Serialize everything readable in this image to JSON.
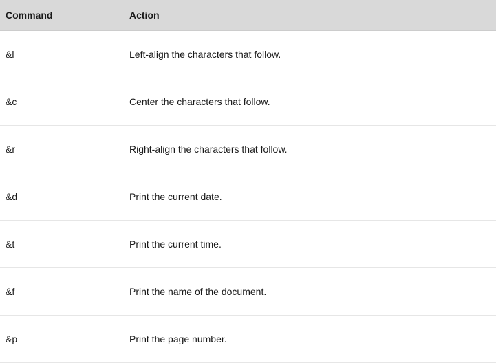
{
  "table": {
    "headers": {
      "command": "Command",
      "action": "Action"
    },
    "rows": [
      {
        "command": "&l",
        "action": "Left-align the characters that follow."
      },
      {
        "command": "&c",
        "action": "Center the characters that follow."
      },
      {
        "command": "&r",
        "action": "Right-align the characters that follow."
      },
      {
        "command": "&d",
        "action": "Print the current date."
      },
      {
        "command": "&t",
        "action": "Print the current time."
      },
      {
        "command": "&f",
        "action": "Print the name of the document."
      },
      {
        "command": "&p",
        "action": "Print the page number."
      }
    ]
  }
}
